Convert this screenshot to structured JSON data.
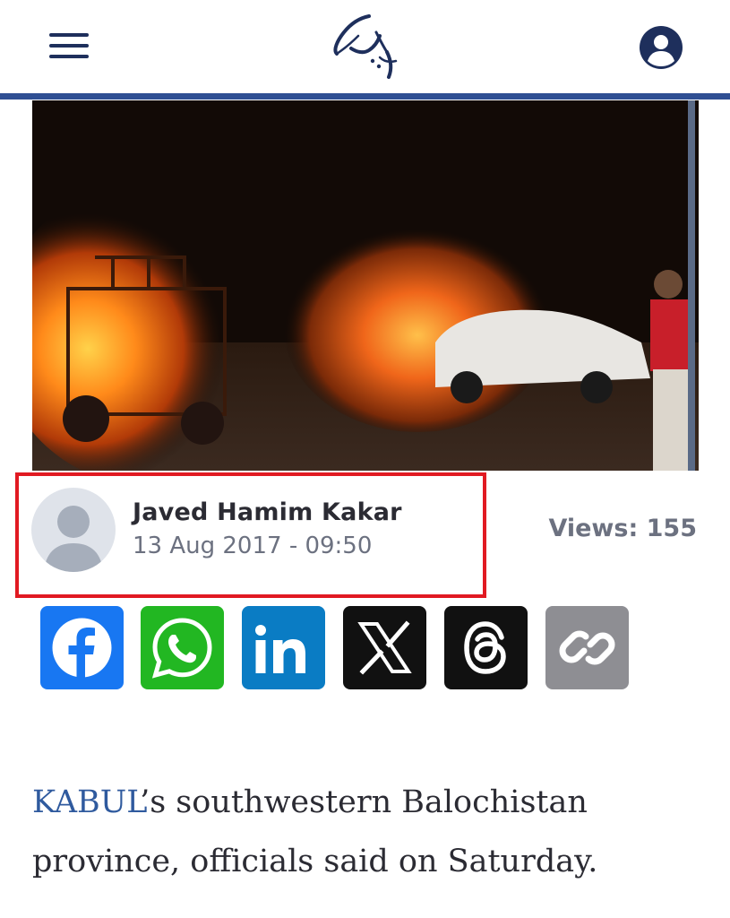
{
  "header": {
    "menu_icon": "hamburger-menu-icon",
    "logo_icon": "site-logo",
    "account_icon": "user-account-icon",
    "accent_color": "#2f4f93"
  },
  "hero": {
    "image_desc_icon": "news-photo"
  },
  "byline": {
    "author": "Javed Hamim Kakar",
    "date": "13 Aug 2017 - 09:50",
    "views": "Views: 155",
    "highlight_color": "#e11a22"
  },
  "share": [
    {
      "name": "facebook",
      "icon": "facebook-icon",
      "color": "#1877f2"
    },
    {
      "name": "whatsapp",
      "icon": "whatsapp-icon",
      "color": "#22b722"
    },
    {
      "name": "linkedin",
      "icon": "linkedin-icon",
      "color": "#0a7cc4"
    },
    {
      "name": "x",
      "icon": "x-icon",
      "color": "#111111"
    },
    {
      "name": "threads",
      "icon": "threads-icon",
      "color": "#111111"
    },
    {
      "name": "copy-link",
      "icon": "link-icon",
      "color": "#8e8e93"
    }
  ],
  "article": {
    "link_text": "KABUL",
    "text": "’s southwestern Balochistan province, officials said on Saturday."
  }
}
